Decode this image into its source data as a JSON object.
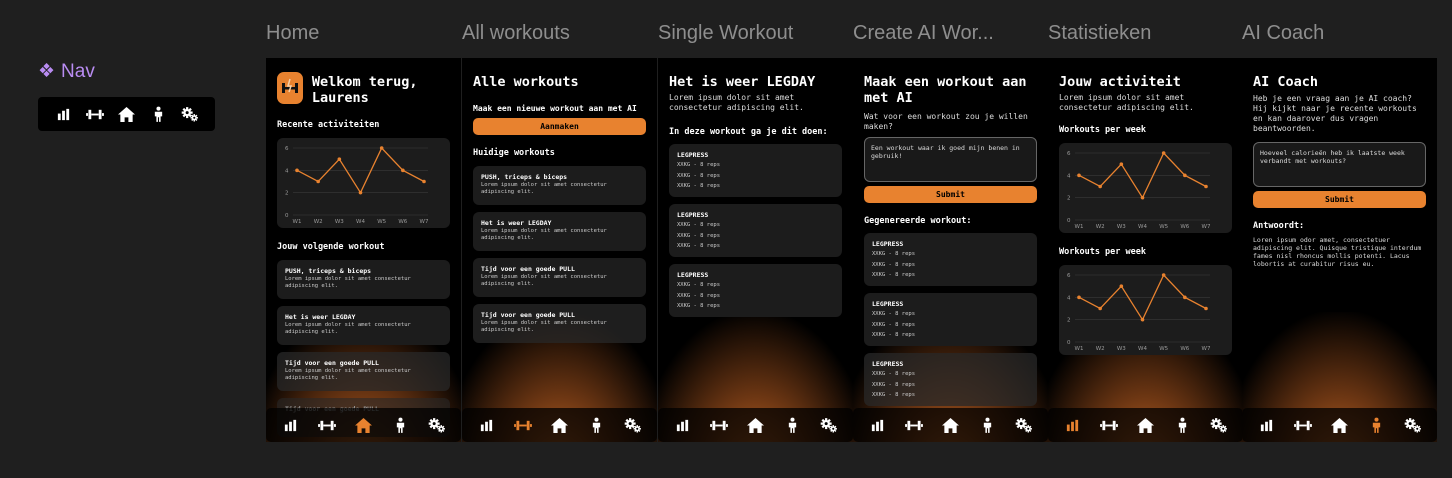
{
  "colors": {
    "accent": "#e8822f",
    "active_nav": "#e8822f",
    "nav_inactive": "#ffffff",
    "background": "#1f1f1f",
    "screen": "#000000",
    "card": "#1c1c1c"
  },
  "component": {
    "label": "Nav",
    "icon": "component-diamond-icon"
  },
  "frames": [
    {
      "title": "Home"
    },
    {
      "title": "All workouts"
    },
    {
      "title": "Single Workout"
    },
    {
      "title": "Create AI Wor..."
    },
    {
      "title": "Statistieken"
    },
    {
      "title": "AI Coach"
    }
  ],
  "home": {
    "welcome": "Welkom terug, Laurens",
    "recent": "Recente activiteiten",
    "next": "Jouw volgende workout",
    "workouts": [
      {
        "title": "PUSH, triceps & biceps",
        "desc": "Lorem ipsum dolor sit amet consectetur adipiscing elit."
      },
      {
        "title": "Het is weer LEGDAY",
        "desc": "Lorem ipsum dolor sit amet consectetur adipiscing elit."
      },
      {
        "title": "Tijd voor een goede PULL",
        "desc": "Lorem ipsum dolor sit amet consectetur adipiscing elit."
      },
      {
        "title": "Tijd voor een goede PULL",
        "desc": ""
      }
    ]
  },
  "all": {
    "title": "Alle workouts",
    "new": "Maak een nieuwe workout aan met AI",
    "button": "Aanmaken",
    "current": "Huidige workouts",
    "workouts": [
      {
        "title": "PUSH, triceps & biceps",
        "desc": "Lorem ipsum dolor sit amet consectetur adipiscing elit."
      },
      {
        "title": "Het is weer LEGDAY",
        "desc": "Lorem ipsum dolor sit amet consectetur adipiscing elit."
      },
      {
        "title": "Tijd voor een goede PULL",
        "desc": "Lorem ipsum dolor sit amet consectetur adipiscing elit."
      },
      {
        "title": "Tijd voor een goede PULL",
        "desc": "Lorem ipsum dolor sit amet consectetur adipiscing elit."
      }
    ]
  },
  "single": {
    "title": "Het is weer LEGDAY",
    "desc": "Lorem ipsum dolor sit amet consectetur adipiscing elit.",
    "heading": "In deze workout ga je dit doen:",
    "exercises": [
      {
        "title": "LEGPRESS",
        "reps": [
          "XXKG - 8 reps",
          "XXKG - 8 reps",
          "XXKG - 8 reps"
        ]
      },
      {
        "title": "LEGPRESS",
        "reps": [
          "XXKG - 8 reps",
          "XXKG - 8 reps",
          "XXKG - 8 reps"
        ]
      },
      {
        "title": "LEGPRESS",
        "reps": [
          "XXKG - 8 reps",
          "XXKG - 8 reps",
          "XXKG - 8 reps"
        ]
      }
    ]
  },
  "create": {
    "title": "Maak een workout aan met AI",
    "question": "Wat voor een workout zou je willen maken?",
    "input": "Een workout waar ik goed mijn benen in gebruik!",
    "button": "Submit",
    "generated": "Gegenereerde workout:",
    "exercises": [
      {
        "title": "LEGPRESS",
        "reps": [
          "XXKG - 8 reps",
          "XXKG - 8 reps",
          "XXKG - 8 reps"
        ]
      },
      {
        "title": "LEGPRESS",
        "reps": [
          "XXKG - 8 reps",
          "XXKG - 8 reps",
          "XXKG - 8 reps"
        ]
      },
      {
        "title": "LEGPRESS",
        "reps": [
          "XXKG - 8 reps",
          "XXKG - 8 reps",
          "XXKG - 8 reps"
        ]
      }
    ]
  },
  "stats": {
    "title": "Jouw activiteit",
    "desc": "Lorem ipsum dolor sit amet consectetur adipiscing elit.",
    "chart1": "Workouts per week",
    "chart2": "Workouts per week"
  },
  "coach": {
    "title": "AI Coach",
    "desc": "Heb je een vraag aan je AI coach? Hij kijkt naar je recente workouts en kan daarover dus vragen beantwoorden.",
    "input": "Hoeveel calorieën heb ik laatste week verbandt met workouts?",
    "button": "Submit",
    "answer_label": "Antwoordt:",
    "answer": "Loren ipsum odor amet, consectetuer adipiscing elit. Quisque tristique interdum fames nisl rhoncus mollis potenti. Lacus lobortis at curabitur risus eu."
  },
  "nav": {
    "icons": [
      "chart-icon",
      "dumbbell-icon",
      "home-icon",
      "person-icon",
      "settings-icon"
    ]
  },
  "chart_data": {
    "type": "line",
    "categories": [
      "W1",
      "W2",
      "W3",
      "W4",
      "W5",
      "W6",
      "W7"
    ],
    "values": [
      4,
      3,
      5,
      2,
      6,
      4,
      3
    ],
    "ylim": [
      0,
      6
    ],
    "yticks": [
      0,
      2,
      4,
      6
    ],
    "grid": true
  }
}
